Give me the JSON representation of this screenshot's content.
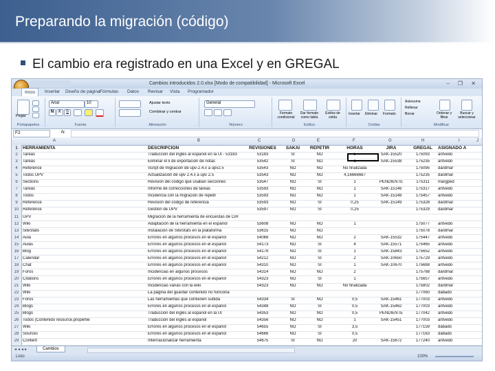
{
  "slide": {
    "title": "Preparando la migración (código)",
    "bullet": "El cambio era registrado en una Excel y en GREGAL"
  },
  "excel": {
    "window_title": "Cambios introducidos 2.0.xlsx [Modo de compatibilidad] - Microsoft Excel",
    "window_controls": "– ❐ ✕",
    "tabs": [
      "Inicio",
      "Insertar",
      "Diseño de página",
      "Fórmulas",
      "Datos",
      "Revisar",
      "Vista",
      "Programador"
    ],
    "ribbon_groups": [
      "Portapapeles",
      "Fuente",
      "Alineación",
      "Número",
      "Estilos",
      "Celdas",
      "Modificar"
    ],
    "ribbon_labels": {
      "paste": "Pegar",
      "font_name": "Arial",
      "font_size": "10",
      "wrap": "Ajustar texto",
      "merge": "Combinar y centrar",
      "number_format": "General",
      "cond_format": "Formato condicional",
      "table_format": "Dar formato como tabla",
      "cell_styles": "Estilos de celda",
      "insert": "Insertar",
      "delete": "Eliminar",
      "format": "Formato",
      "autosum": "Autosuma",
      "fill": "Rellenar",
      "clear": "Borrar",
      "sort": "Ordenar y filtrar",
      "find": "Buscar y seleccionar"
    },
    "name_box": "F2",
    "fx": "fx",
    "column_letters": [
      "A",
      "B",
      "C",
      "D",
      "E",
      "F",
      "G",
      "H",
      "I",
      "J"
    ],
    "headers": [
      "HERRAMIENTA",
      "DESCRIPCIÓN",
      "REVISIONES",
      "SAKAI",
      "REPETIR",
      "HORAS",
      "JIRA",
      "GREGAL",
      "ASIGNADO A"
    ],
    "rows": [
      [
        "Tareas",
        "Traducción del inglés al español en la UI - 53183",
        "53183",
        "SI",
        "NO",
        "5",
        "SAK-15520",
        "175093",
        "antvedo"
      ],
      [
        "Tareas",
        "Eliminar el li de exportación de notas",
        "53542",
        "SI",
        "NO",
        "1",
        "SAK-15538",
        "175235",
        "antvedo"
      ],
      [
        "Reference",
        "Script de migración de upv-2.4.x a upv2.5",
        "53543",
        "NO",
        "NO",
        "No finalizada",
        "",
        "175095",
        "dardmar"
      ],
      [
        "Todos UPV",
        "Actualización de upv 2.4.x a upv 2.5",
        "53543",
        "NO",
        "NO",
        "4,16666667",
        "",
        "175235",
        "dardmar"
      ],
      [
        "Sections",
        "Revisión del código que usaban secciones",
        "53547",
        "NO",
        "SI",
        "1",
        "PENDIENTE",
        "175311",
        "margped"
      ],
      [
        "Tareas",
        "Informe de correcciones de tareas",
        "53593",
        "NO",
        "NO",
        "1",
        "SAK-15146",
        "175317",
        "antvedo"
      ],
      [
        "Todos",
        "Incidencia con la migración de repetir",
        "53593",
        "NO",
        "NO",
        "1",
        "SAK-15148",
        "175457",
        "antvedo"
      ],
      [
        "Reference",
        "Revisión del código de referencia",
        "53593",
        "NO",
        "SI",
        "0,25",
        "SAK-15149",
        "175328",
        "dardmar"
      ],
      [
        "Reference",
        "Gestión de UPV",
        "53597",
        "NO",
        "SI",
        "0,25",
        "",
        "175329",
        "dardmar"
      ],
      [
        "UPV",
        "Migración de la herramienta de encuestas de CiH",
        "",
        "",
        "",
        "",
        "",
        "",
        ""
      ],
      [
        "Wiki",
        "Adaptación de la herramienta en el español",
        "53608",
        "NO",
        "NO",
        "1",
        "",
        "175077",
        "antvedo"
      ],
      [
        "SiteStats",
        "Instalación de SiteStats en la plataforma",
        "53615",
        "NO",
        "NO",
        "",
        "",
        "175078",
        "dardmar"
      ],
      [
        "Aula",
        "Errores en algunos procesos en el español",
        "54068",
        "NO",
        "NO",
        "2",
        "SAK-15532",
        "175447",
        "antvedo"
      ],
      [
        "Aulas",
        "Errores en algunos procesos en el español",
        "54173",
        "NO",
        "SI",
        "4",
        "SAK-15571",
        "175465",
        "antvedo"
      ],
      [
        "Blog",
        "Errores en algunos procesos en el español",
        "54178",
        "NO",
        "SI",
        "1",
        "SAK-15843",
        "175652",
        "antvedo"
      ],
      [
        "Calendar",
        "Errores en algunos procesos en el español",
        "54212",
        "NO",
        "SI",
        "2",
        "SAK-10650",
        "175729",
        "antvedo"
      ],
      [
        "Chat",
        "Errores en algunos procesos en el español",
        "54310",
        "NO",
        "SI",
        "1",
        "SAK-10670",
        "175688",
        "antvedo"
      ],
      [
        "Foros",
        "Incidencias en algunos procesos",
        "54314",
        "NO",
        "NO",
        "2",
        "",
        "175768",
        "dardmar"
      ],
      [
        "Citations",
        "Errores en algunos procesos en el español",
        "54323",
        "NO",
        "SI",
        "1",
        "",
        "175657",
        "antvedo"
      ],
      [
        "Wiki",
        "Incidencias varias con la wiki",
        "54323",
        "NO",
        "NO",
        "No finalizada",
        "",
        "175802",
        "dardmar"
      ],
      [
        "Wiki",
        "La página del guardar contenido no funciona",
        "",
        "",
        "",
        "",
        "",
        "177060",
        "dabado"
      ],
      [
        "Foros",
        "Las herramientas que contienen subida",
        "54334",
        "SI",
        "NO",
        "0,5",
        "SAK-15461",
        "177003",
        "antvedo"
      ],
      [
        "Blogs",
        "Errores en algunos procesos en el español",
        "54348",
        "NO",
        "SI",
        "0,5",
        "SAK-15462",
        "177003",
        "antvedo"
      ],
      [
        "Blogs",
        "Traducción del inglés al español en la UI",
        "54353",
        "NO",
        "NO",
        "0,5",
        "PENDIENTE",
        "177042",
        "antvedo"
      ],
      [
        "Todos (Contenido resource.properties)",
        "Traducción del inglés al español",
        "54356",
        "NO",
        "NO",
        "1",
        "SAK-15451",
        "177003",
        "antvedo"
      ],
      [
        "Wiki",
        "Errores en algunos procesos en el español",
        "54655",
        "NO",
        "SI",
        "3,5",
        "",
        "177159",
        "dabado"
      ],
      [
        "Sources",
        "Errores en algunos procesos en el español",
        "54666",
        "NO",
        "SI",
        "0,5",
        "",
        "177163",
        "dabado"
      ],
      [
        "Content",
        "Internacionalizar herramienta",
        "54675",
        "SI",
        "NO",
        "20",
        "SAK-15672",
        "177240",
        "antvedo"
      ],
      [
        "Gradebook",
        "Internacionalizar herramienta",
        "54697",
        "NO",
        "NO",
        "20",
        "SAK-15672",
        "177347",
        "antvedo"
      ]
    ],
    "sheet_tab": "Cambios",
    "status_left": "Listo",
    "zoom": "100%"
  }
}
